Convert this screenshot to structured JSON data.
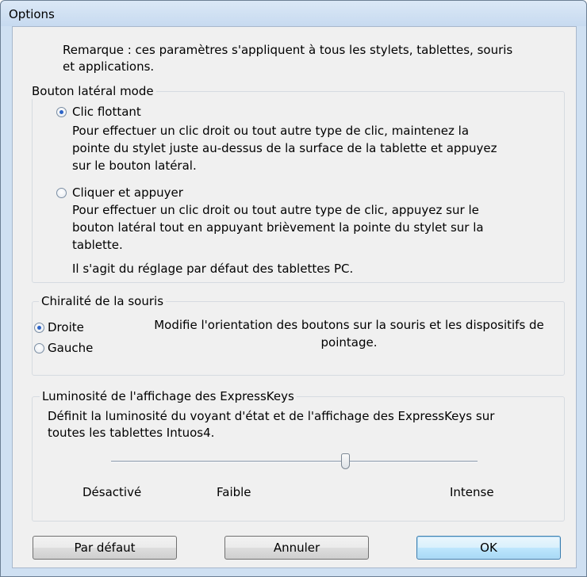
{
  "window": {
    "title": "Options",
    "note": "Remarque : ces paramètres s'appliquent à tous les stylets, tablettes, souris",
    "note_line2": "et applications."
  },
  "side_button_mode": {
    "legend": "Bouton latéral mode",
    "options": [
      {
        "label": "Clic flottant",
        "selected": true,
        "description_lines": [
          "Pour effectuer un clic droit ou tout autre type de clic, maintenez la",
          "pointe du stylet juste au-dessus de la surface de la tablette et appuyez",
          "sur le bouton latéral."
        ]
      },
      {
        "label": "Cliquer et appuyer",
        "selected": false,
        "description_lines": [
          "Pour effectuer un clic droit ou tout autre type de clic, appuyez sur le",
          "bouton latéral tout en appuyant brièvement la pointe du stylet sur la",
          "tablette."
        ],
        "default_note": "Il s'agit du réglage par défaut des tablettes PC."
      }
    ]
  },
  "handedness": {
    "legend": "Chiralité de la souris",
    "options": [
      {
        "label": "Droite",
        "selected": true
      },
      {
        "label": "Gauche",
        "selected": false
      }
    ],
    "description_line1": "Modifie l'orientation des boutons sur la souris et les dispositifs de",
    "description_line2": "pointage."
  },
  "expresskeys_brightness": {
    "legend": "Luminosité de l'affichage des ExpressKeys",
    "description_line1": "Définit la luminosité du voyant d'état et de l'affichage des ExpressKeys sur",
    "description_line2": "toutes les tablettes Intuos4.",
    "slider_value_fraction": 0.64,
    "labels": {
      "off": "Désactivé",
      "low": "Faible",
      "high": "Intense"
    }
  },
  "buttons": {
    "default_label": "Par défaut",
    "cancel_label": "Annuler",
    "ok_label": "OK"
  }
}
